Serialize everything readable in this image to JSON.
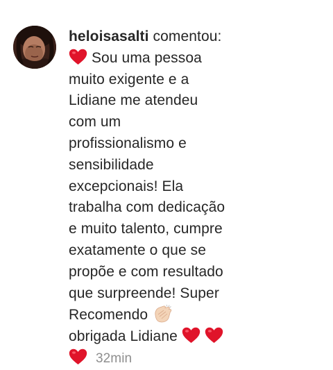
{
  "comment": {
    "username": "heloisasalti",
    "action": "comentou:",
    "lines": [
      "Sou uma pessoa",
      "muito exigente e a",
      "Lidiane me atendeu",
      "com um",
      "profissionalismo e",
      "sensibilidade",
      "excepcionais! Ela",
      "trabalha com dedicação",
      "e muito talento, cumpre",
      "exatamente o que se",
      "propõe e com resultado",
      "que surpreende! Super",
      "Recomendo",
      "obrigada Lidiane"
    ],
    "timestamp": "32min"
  },
  "icons": {
    "avatar": "user-avatar",
    "heart": "red-heart-icon",
    "clap": "clapping-hands-icon"
  },
  "colors": {
    "text": "#262626",
    "timestamp": "#8e8e8e",
    "heart": "#e0142a",
    "clap_skin": "#f3d4b8"
  }
}
